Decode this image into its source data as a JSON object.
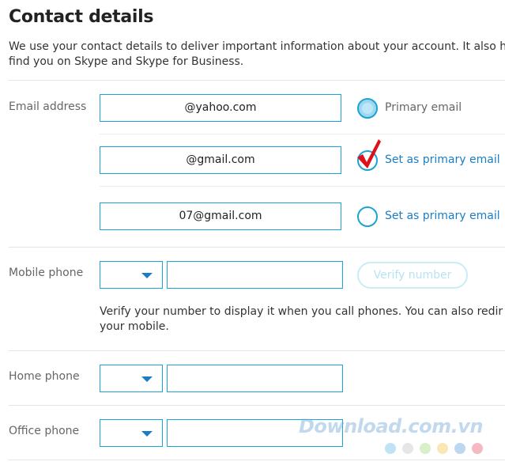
{
  "page": {
    "title": "Contact details",
    "intro_line1": "We use your contact details to deliver important information about your account. It also h",
    "intro_line2": "find you on Skype and Skype for Business."
  },
  "email": {
    "label": "Email address",
    "rows": [
      {
        "value": "@yahoo.com",
        "radio_label": "Primary email",
        "selected": true
      },
      {
        "value": "@gmail.com",
        "radio_label": "Set as primary email",
        "selected": false
      },
      {
        "value": "07@gmail.com",
        "radio_label": "Set as primary email",
        "selected": false
      }
    ]
  },
  "mobile": {
    "label": "Mobile phone",
    "verify_label": "Verify number",
    "note_line1": "Verify your number to display it when you call phones. You can also redir",
    "note_line2": "your mobile."
  },
  "home": {
    "label": "Home phone"
  },
  "office": {
    "label": "Office phone"
  },
  "watermark": {
    "text": "Download.com.vn",
    "dot_colors": [
      "#bfe3f5",
      "#e6e6e6",
      "#d9efc9",
      "#fbe7b6",
      "#bcd8f0",
      "#f6b9c3"
    ]
  },
  "colors": {
    "accent": "#1ca2d3",
    "link": "#1a7dc4",
    "check": "#e0101a"
  }
}
